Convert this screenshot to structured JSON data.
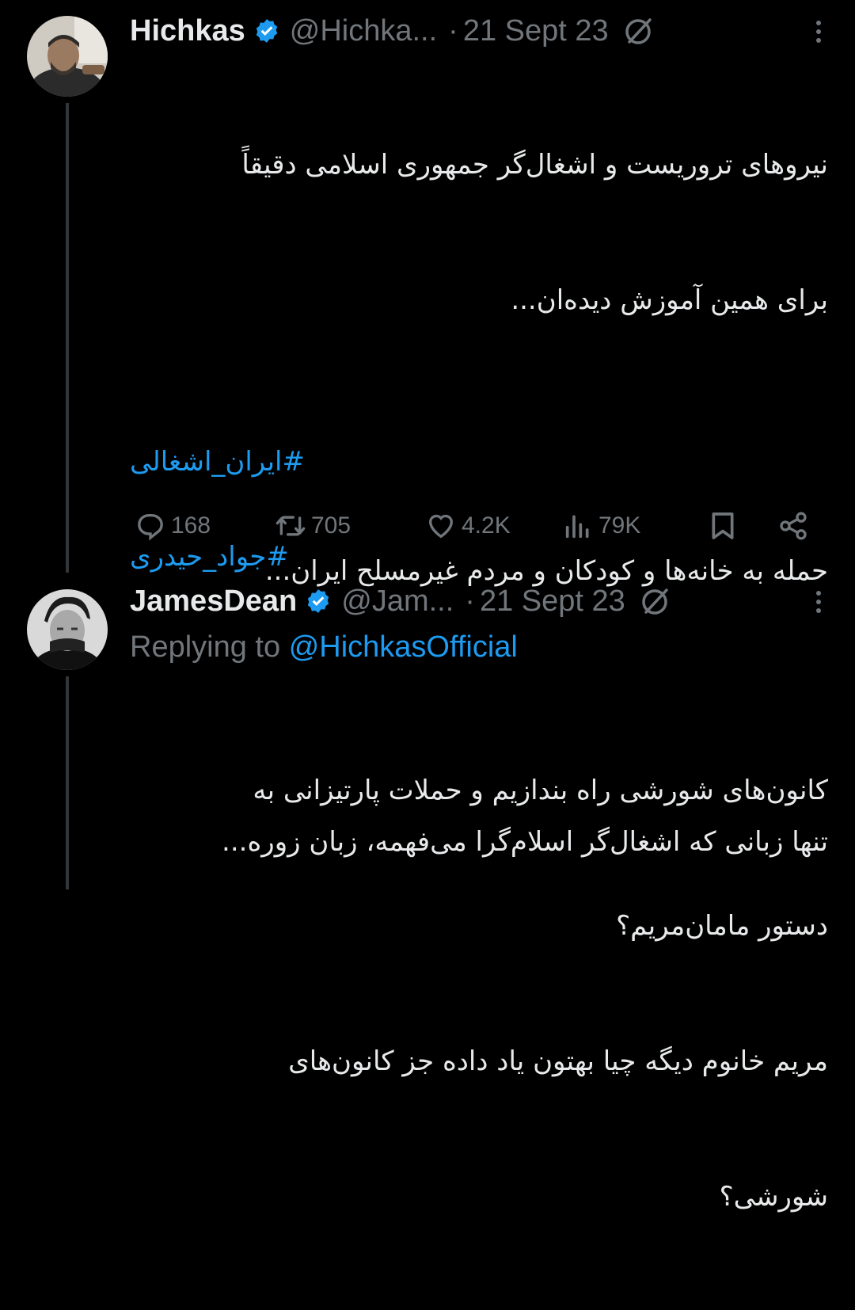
{
  "colors": {
    "background": "#000000",
    "text": "#e7e9ea",
    "muted": "#71767b",
    "link": "#1d9bf0",
    "verified": "#1d9bf0"
  },
  "tweets": [
    {
      "name": "Hichkas",
      "handle": "@Hichka...",
      "dot": "·",
      "date": "21 Sept 23",
      "avatar_icon": "avatar-photo",
      "lines": [
        "نیروهای تروریست و اشغال‌گر جمهوری اسلامی دقیقاً",
        "برای همین آموزش دیده‌ان...",
        "",
        "حمله به خانه‌ها و کودکان و مردم غیرمسلح ایران...",
        "",
        "تنها زبانی که اشغال‌گر اسلام‌گرا می‌فهمه، زبان زوره...",
        ""
      ],
      "hashtags": [
        "#ایران_اشغالی",
        "#جواد_حیدری"
      ],
      "stats": {
        "replies": "168",
        "retweets": "705",
        "likes": "4.2K",
        "views": "79K"
      }
    },
    {
      "name": "JamesDean",
      "handle": "@Jam...",
      "dot": "·",
      "date": "21 Sept 23",
      "avatar_icon": "avatar-photo",
      "replying_prefix": "Replying to",
      "replying_handle": "@HichkasOfficial",
      "lines": [
        "کانون‌های شورشی راه بندازیم و حملات پارتیزانی به",
        "دستور مامان‌مریم؟",
        "مریم خانوم دیگه چیا بهتون یاد داده جز کانون‌های",
        "شورشی؟"
      ]
    }
  ]
}
